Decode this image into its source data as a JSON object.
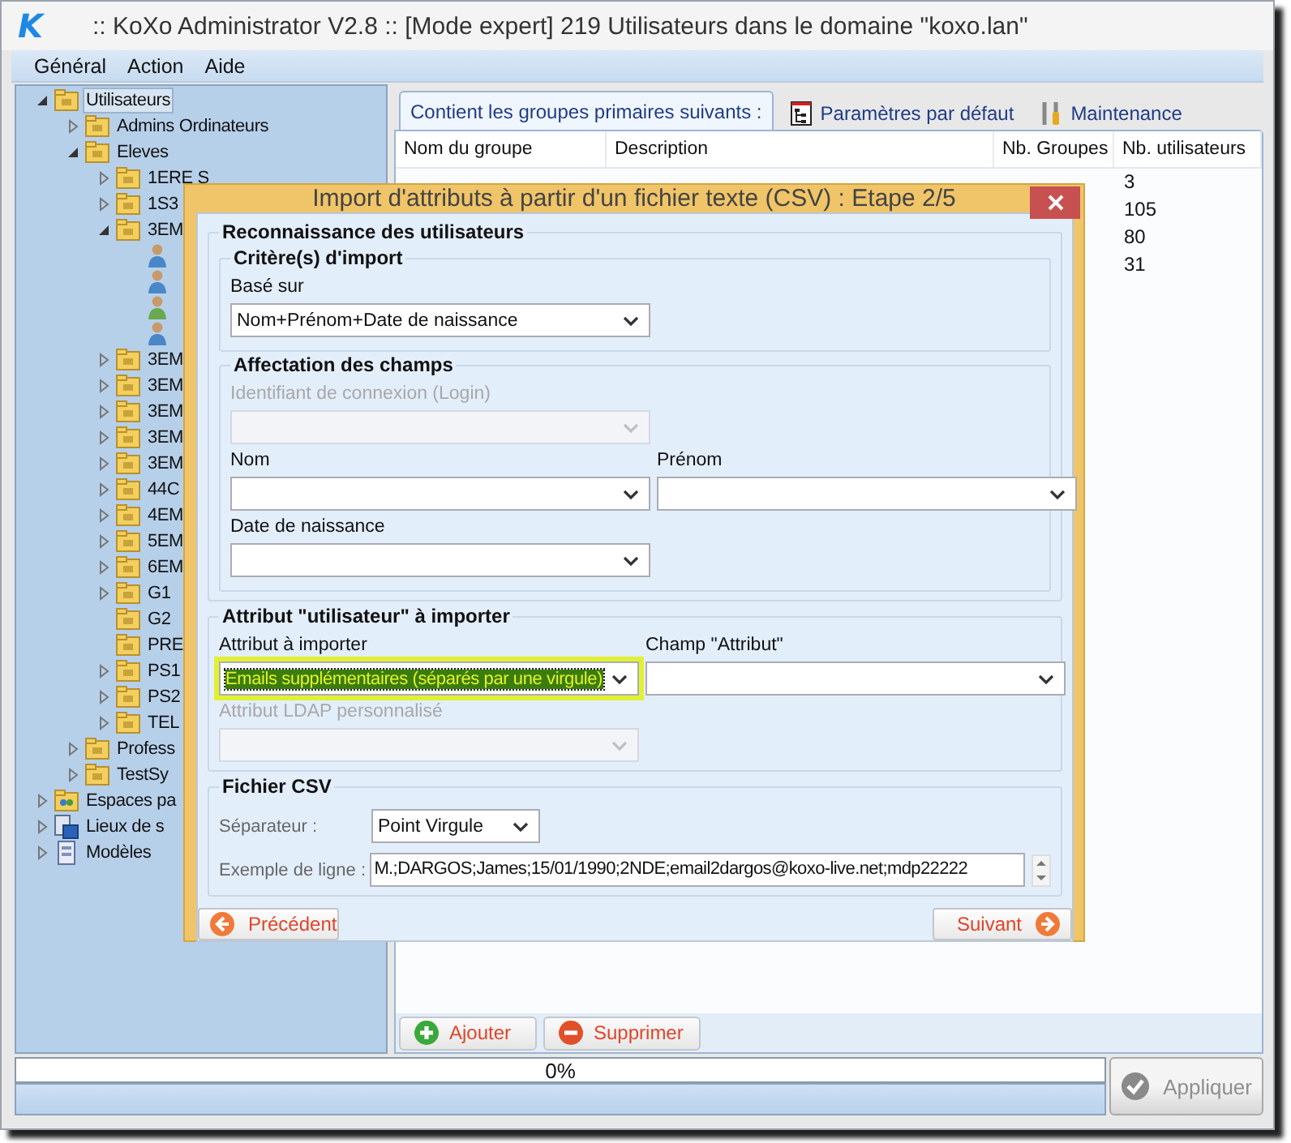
{
  "window": {
    "logo": "K",
    "title": ":: KoXo Administrator V2.8 :: [Mode expert] 219 Utilisateurs dans le domaine \"koxo.lan\""
  },
  "menu": [
    "Général",
    "Action",
    "Aide"
  ],
  "tree": [
    {
      "label": "Utilisateurs",
      "kind": "folder",
      "expanded": true,
      "selected": true,
      "children": [
        {
          "label": "Admins Ordinateurs",
          "kind": "folder",
          "expanded": false,
          "selected": false
        },
        {
          "label": "Eleves",
          "kind": "folder",
          "expanded": true,
          "selected": false,
          "children": [
            {
              "label": "1ERE S",
              "kind": "folder",
              "expanded": false,
              "selected": false
            },
            {
              "label": "1S3",
              "kind": "folder",
              "expanded": false,
              "selected": false
            },
            {
              "label": "3EM",
              "kind": "folder",
              "expanded": true,
              "selected": false,
              "children": [
                {
                  "kind": "user",
                  "selected": false,
                  "color": "#4a86c8"
                },
                {
                  "kind": "user",
                  "selected": false,
                  "color": "#4a86c8"
                },
                {
                  "kind": "user",
                  "selected": false,
                  "color": "#6aa84f"
                },
                {
                  "kind": "user",
                  "selected": false,
                  "color": "#4a86c8"
                }
              ]
            },
            {
              "label": "3EM",
              "kind": "folder",
              "expanded": false,
              "selected": false
            },
            {
              "label": "3EM",
              "kind": "folder",
              "expanded": false,
              "selected": false
            },
            {
              "label": "3EM",
              "kind": "folder",
              "expanded": false,
              "selected": false
            },
            {
              "label": "3EM",
              "kind": "folder",
              "expanded": false,
              "selected": false
            },
            {
              "label": "3EM",
              "kind": "folder",
              "expanded": false,
              "selected": false
            },
            {
              "label": "44C",
              "kind": "folder",
              "expanded": false,
              "selected": false
            },
            {
              "label": "4EM",
              "kind": "folder",
              "expanded": false,
              "selected": false
            },
            {
              "label": "5EM",
              "kind": "folder",
              "expanded": false,
              "selected": false
            },
            {
              "label": "6EM",
              "kind": "folder",
              "expanded": false,
              "selected": false
            },
            {
              "label": "G1",
              "kind": "folder",
              "expanded": false,
              "selected": false
            },
            {
              "label": "G2",
              "kind": "folder",
              "selected": false
            },
            {
              "label": "PRE",
              "kind": "folder",
              "selected": false
            },
            {
              "label": "PS1",
              "kind": "folder",
              "expanded": false,
              "selected": false
            },
            {
              "label": "PS2",
              "kind": "folder",
              "expanded": false,
              "selected": false
            },
            {
              "label": "TEL",
              "kind": "folder",
              "expanded": false,
              "selected": false
            }
          ]
        },
        {
          "label": "Profess",
          "kind": "folder",
          "expanded": false,
          "selected": false
        },
        {
          "label": "TestSy",
          "kind": "folder",
          "expanded": false,
          "selected": false
        }
      ]
    },
    {
      "label": "Espaces pa",
      "kind": "shared_folder",
      "expanded": false,
      "selected": false
    },
    {
      "label": "Lieux de s",
      "kind": "computer",
      "expanded": false,
      "selected": false
    },
    {
      "label": "Modèles",
      "kind": "document",
      "expanded": false,
      "selected": false
    }
  ],
  "tabs": [
    {
      "label": "Contient les groupes primaires suivants :",
      "selected": true
    },
    {
      "label": "Paramètres par défaut",
      "selected": false
    },
    {
      "label": "Maintenance",
      "selected": false
    }
  ],
  "table": {
    "columns": [
      "Nom du groupe",
      "Description",
      "Nb. Groupes",
      "Nb. utilisateurs"
    ],
    "rows": [
      {
        "nb_utilisateurs": "3"
      },
      {
        "nb_utilisateurs": "105"
      },
      {
        "nb_utilisateurs": "80"
      },
      {
        "nb_utilisateurs": "31"
      }
    ]
  },
  "panel_buttons": [
    {
      "label": "Ajouter",
      "kind": "add"
    },
    {
      "label": "Supprimer",
      "kind": "remove"
    }
  ],
  "progress": {
    "label": "0%",
    "level": 0
  },
  "apply_button": {
    "label": "Appliquer",
    "disabled": true
  },
  "dialog": {
    "title": "Import d'attributs à partir d'un fichier texte (CSV) : Etape 2/5",
    "groups": [
      {
        "title": "Reconnaissance des utilisateurs",
        "subgroups": [
          {
            "title": "Critère(s) d'import",
            "rows": [
              [
                {
                  "label": "Basé sur",
                  "value": "Nom+Prénom+Date de naissance",
                  "disabled": false,
                  "highlighted": false
                }
              ]
            ]
          },
          {
            "title": "Affectation des champs",
            "rows": [
              [
                {
                  "label": "Identifiant de connexion (Login)",
                  "disabled": true,
                  "highlighted": false
                }
              ],
              [
                {
                  "label": "Nom",
                  "disabled": false,
                  "highlighted": false
                },
                {
                  "label": "Prénom",
                  "disabled": false,
                  "highlighted": false
                }
              ],
              [
                {
                  "label": "Date de naissance",
                  "disabled": false,
                  "highlighted": false
                }
              ]
            ]
          }
        ]
      },
      {
        "title": "Attribut \"utilisateur\" à importer",
        "rows": [
          [
            {
              "label": "Attribut à importer",
              "value": "Emails supplémentaires (séparés par une virgule)",
              "disabled": false,
              "highlighted": true
            },
            {
              "label": "Champ \"Attribut\"",
              "disabled": false,
              "highlighted": false
            }
          ],
          [
            {
              "label": "Attribut LDAP personnalisé",
              "disabled": true,
              "highlighted": false
            }
          ]
        ]
      },
      {
        "title": "Fichier CSV",
        "kind": "inline",
        "rows": [
          [
            {
              "label": "Séparateur :",
              "kind": "select",
              "value": "Point Virgule"
            }
          ],
          [
            {
              "label": "Exemple de ligne :",
              "kind": "text",
              "value": "M.;DARGOS;James;15/01/1990;2NDE;email2dargos@koxo-live.net;mdp22222"
            }
          ]
        ]
      }
    ],
    "buttons": [
      {
        "label": "Précédent",
        "kind": "back"
      },
      {
        "label": "Suivant",
        "kind": "next"
      }
    ]
  }
}
